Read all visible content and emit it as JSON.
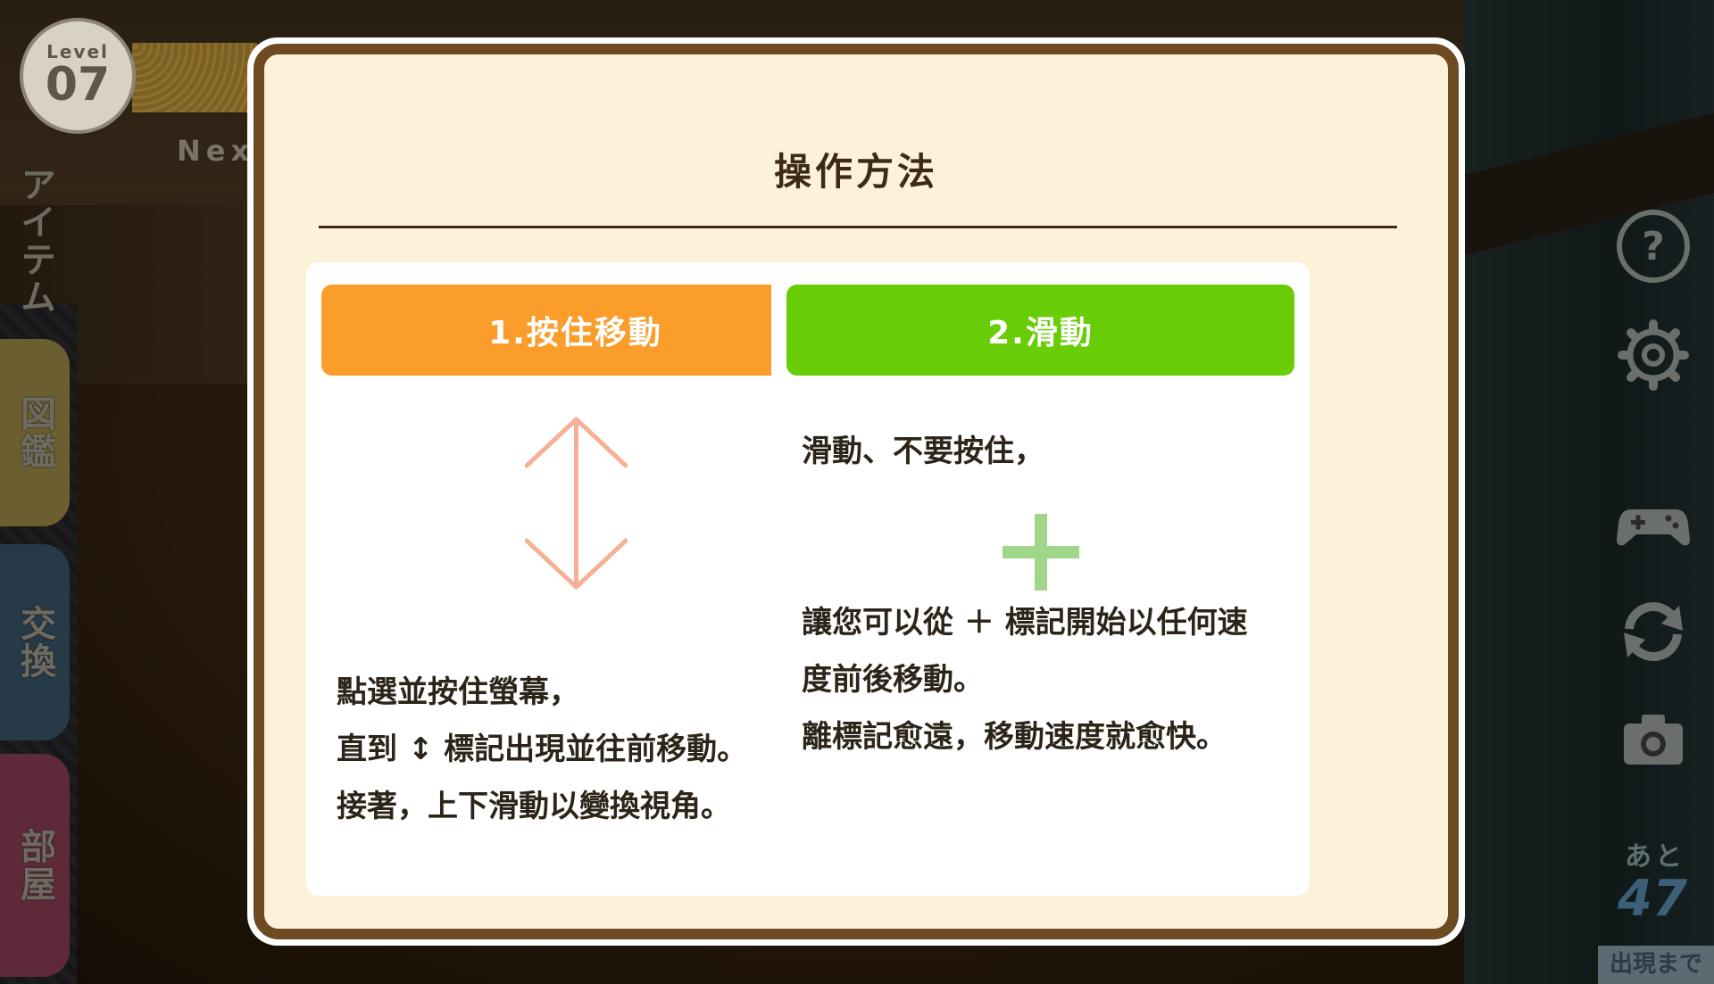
{
  "hud": {
    "level_label": "Level",
    "level_number": "07",
    "next_label": "Nex",
    "side_tabs": [
      {
        "label": "アイテム"
      },
      {
        "label": "図鑑"
      },
      {
        "label": "交換"
      },
      {
        "label": "部屋"
      }
    ],
    "right_buttons": [
      "help-icon",
      "gear-icon",
      "gamepad-icon",
      "refresh-icon",
      "camera-icon"
    ],
    "remain_label": "あと",
    "remain_count": "47",
    "remain_footer": "出現まで"
  },
  "modal": {
    "title": "操作方法",
    "cards": [
      {
        "header": "1.按住移動",
        "header_color": "#fb9d2b",
        "icon": "up-down-arrow-icon",
        "lines": [
          "點選並按住螢幕，",
          "直到 ↕ 標記出現並往前移動。",
          "接著，上下滑動以變換視角。"
        ]
      },
      {
        "header": "2.滑動",
        "header_color": "#68cc07",
        "intro": "滑動、不要按住，",
        "icon": "plus-marker-icon",
        "lines": [
          "讓您可以從 ＋ 標記開始以任何速",
          "度前後移動。",
          "離標記愈遠，移動速度就愈快。"
        ]
      }
    ]
  },
  "colors": {
    "frame": "#6e4a22",
    "panel": "#fdf1da",
    "arrow": "#f6b096",
    "plus": "#9fd68a"
  }
}
